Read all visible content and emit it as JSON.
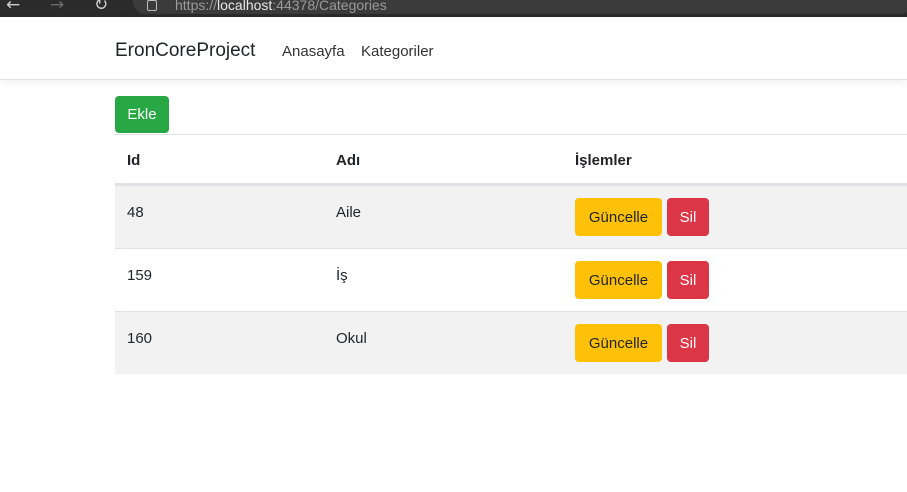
{
  "browser": {
    "url_scheme": "https://",
    "url_host": "localhost",
    "url_rest": ":44378/Categories"
  },
  "navbar": {
    "brand": "EronCoreProject",
    "links": [
      "Anasayfa",
      "Kategoriler"
    ]
  },
  "main": {
    "add_label": "Ekle",
    "table": {
      "headers": [
        "Id",
        "Adı",
        "İşlemler"
      ],
      "rows": [
        {
          "id": "48",
          "name": "Aile",
          "update_label": "Güncelle",
          "delete_label": "Sil"
        },
        {
          "id": "159",
          "name": "İş",
          "update_label": "Güncelle",
          "delete_label": "Sil"
        },
        {
          "id": "160",
          "name": "Okul",
          "update_label": "Güncelle",
          "delete_label": "Sil"
        }
      ]
    }
  },
  "colors": {
    "success": "#28a745",
    "warning": "#ffc107",
    "danger": "#dc3545"
  }
}
